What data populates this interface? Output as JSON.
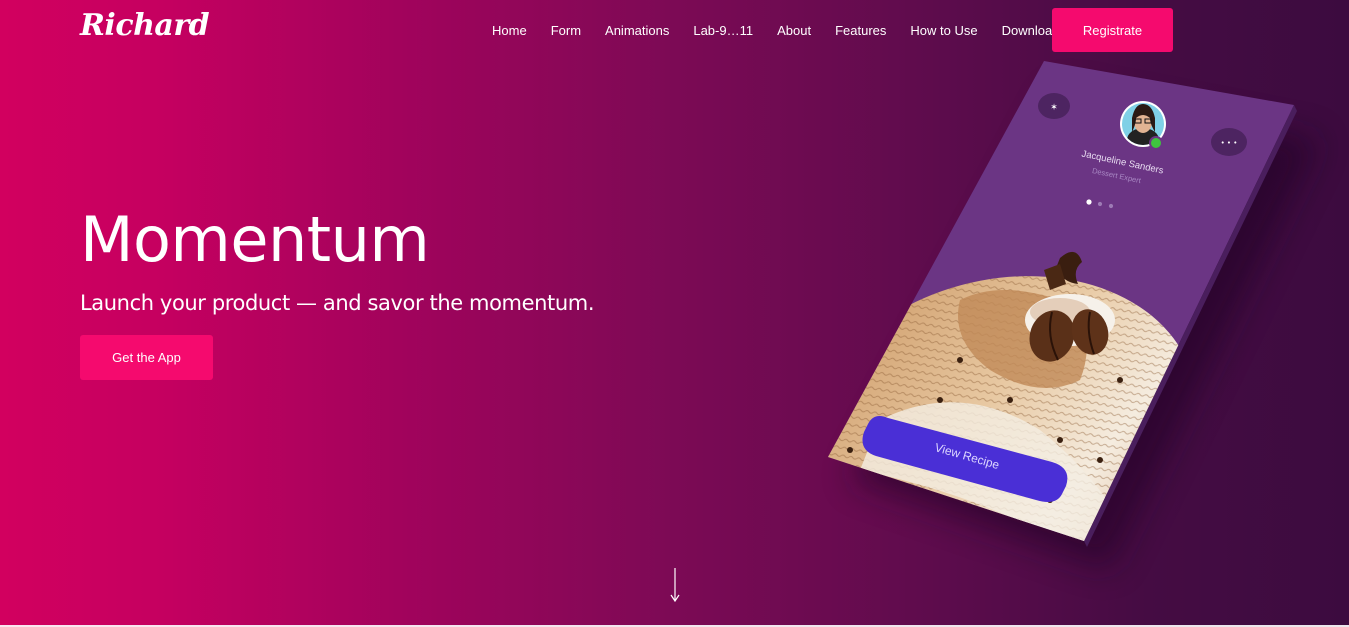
{
  "brand": {
    "logo_text": "Richard"
  },
  "nav": {
    "links": [
      "Home",
      "Form",
      "Animations",
      "Lab-9…11",
      "About",
      "Features",
      "How to Use",
      "Download"
    ],
    "register_label": "Registrate"
  },
  "hero": {
    "title": "Momentum",
    "subtitle": "Launch your product — and savor the momentum.",
    "cta_label": "Get the App"
  },
  "phone": {
    "profile_name": "Jacqueline Sanders",
    "profile_role": "Dessert Expert",
    "recipe_button_label": "View Recipe",
    "menu_dots": "• • •",
    "carousel_dots": 3,
    "carousel_active_index": 0
  },
  "icons": {
    "scroll": "arrow-down-icon",
    "phone_left": "star-icon",
    "phone_right": "more-dots-icon"
  },
  "colors": {
    "accent": "#f50a6e",
    "gradient_left": "#d2005f",
    "gradient_right": "#3c0b3f",
    "phone_screen": "#6b3584",
    "recipe_button": "#4a2fd6",
    "status_online": "#3fc43f"
  }
}
